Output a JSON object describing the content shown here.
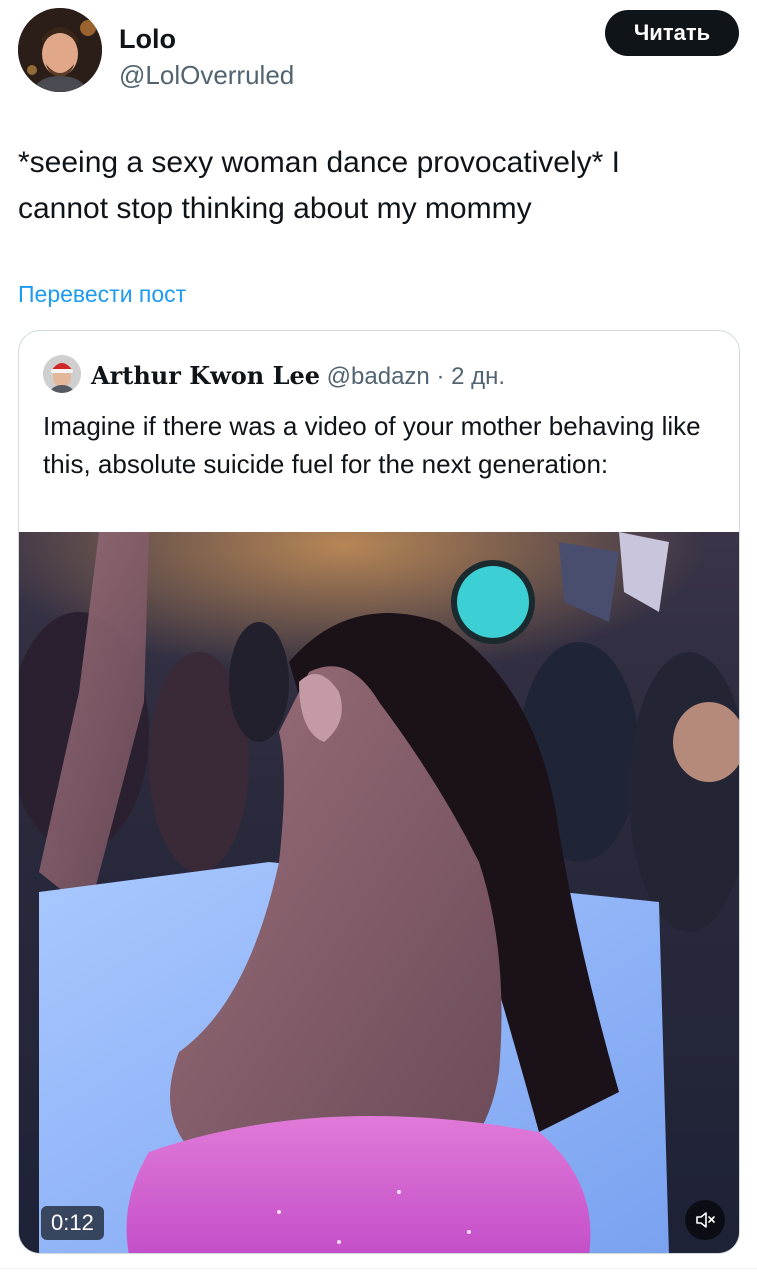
{
  "post": {
    "author_name": "Lolo",
    "author_handle": "@LolOverruled",
    "follow_label": "Читать",
    "text": "*seeing a sexy woman dance provocatively* I cannot stop thinking about my mommy",
    "translate_label": "Перевести пост"
  },
  "quoted_post": {
    "author_name": "Arthur Kwon Lee",
    "author_handle": "@badazn",
    "separator": "·",
    "time": "2 дн.",
    "text": "Imagine if there was a video of your mother behaving like this, absolute suicide fuel for the next generation:",
    "video": {
      "duration": "0:12",
      "mute_icon": "speaker-muted-icon"
    }
  },
  "colors": {
    "text_primary": "#0f1419",
    "text_secondary": "#536471",
    "link": "#1d9bf0",
    "border": "#cfd9de",
    "button_bg": "#0f1419"
  }
}
